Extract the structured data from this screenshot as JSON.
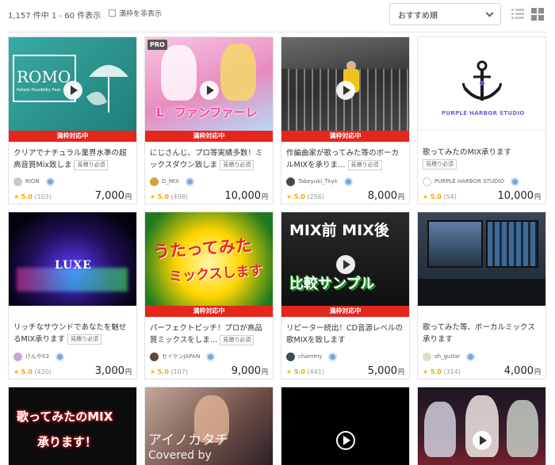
{
  "header": {
    "result_count": "1,157 件中 1 - 60 件表示",
    "hide_full_label": "満枠を非表示",
    "sort_selected": "おすすめ順"
  },
  "common": {
    "banner_label": "満枠対応中",
    "quote_tag": "見積り必須",
    "yen": "円"
  },
  "thumb_text": {
    "card1_logo": "ROMO",
    "card1_sub": "Pallete Possibility Feat. Sumi",
    "card2_pro": "PRO",
    "card2_title": "L♡ファンファーレ",
    "card4_studio": "PURPLE HARBOR STUDIO",
    "card5_logo": "LUXE",
    "card6_line1": "うたってみた",
    "card6_line2": "ミックスします",
    "card7_top": "MIX前 MIX後",
    "card7_bottom": "比較サンプル",
    "card9_line1": "歌ってみたのMIX",
    "card9_line2": "承ります！",
    "card10_line1": "アイノカタチ",
    "card10_line2": "Covered by"
  },
  "cards": [
    {
      "title": "クリアでナチュラル業界水準の超高音質Mix致しま",
      "seller": "RION",
      "score": "5.0",
      "reviews": "(103)",
      "price": "7,000",
      "banner": true,
      "tag": true
    },
    {
      "title": "にじさんじ、プロ等実績多数！ミックスダウン致しま",
      "seller": "D_MIX",
      "score": "5.0",
      "reviews": "(498)",
      "price": "10,000",
      "banner": true,
      "tag": true
    },
    {
      "title": "作編曲家が歌ってみた等のボーカルMIXを承りま…",
      "seller": "Takeyuki_Tkyk",
      "score": "5.0",
      "reviews": "(256)",
      "price": "8,000",
      "banner": true,
      "tag": true
    },
    {
      "title": "歌ってみたのMIX承ります",
      "seller": "PURPLE HARBOR STUDIO",
      "score": "5.0",
      "reviews": "(54)",
      "price": "10,000",
      "banner": false,
      "tag": true
    },
    {
      "title": "リッチなサウンドであなたを魅せるMIX承ります",
      "seller": "けんや03",
      "score": "5.0",
      "reviews": "(420)",
      "price": "3,000",
      "banner": false,
      "tag": true
    },
    {
      "title": "パーフェクトピッチ！プロが高品質ミックスをしま…",
      "seller": "セイケンJAPAN",
      "score": "5.0",
      "reviews": "(107)",
      "price": "9,000",
      "banner": true,
      "tag": true
    },
    {
      "title": "リピーター続出！CD音源レベルの歌MIXを致します",
      "seller": "chammy",
      "score": "5.0",
      "reviews": "(441)",
      "price": "5,000",
      "banner": true,
      "tag": false
    },
    {
      "title": "歌ってみた等、ボーカルミックス承ります",
      "seller": "sh_guitar",
      "score": "5.0",
      "reviews": "(314)",
      "price": "4,000",
      "banner": false,
      "tag": false
    }
  ]
}
